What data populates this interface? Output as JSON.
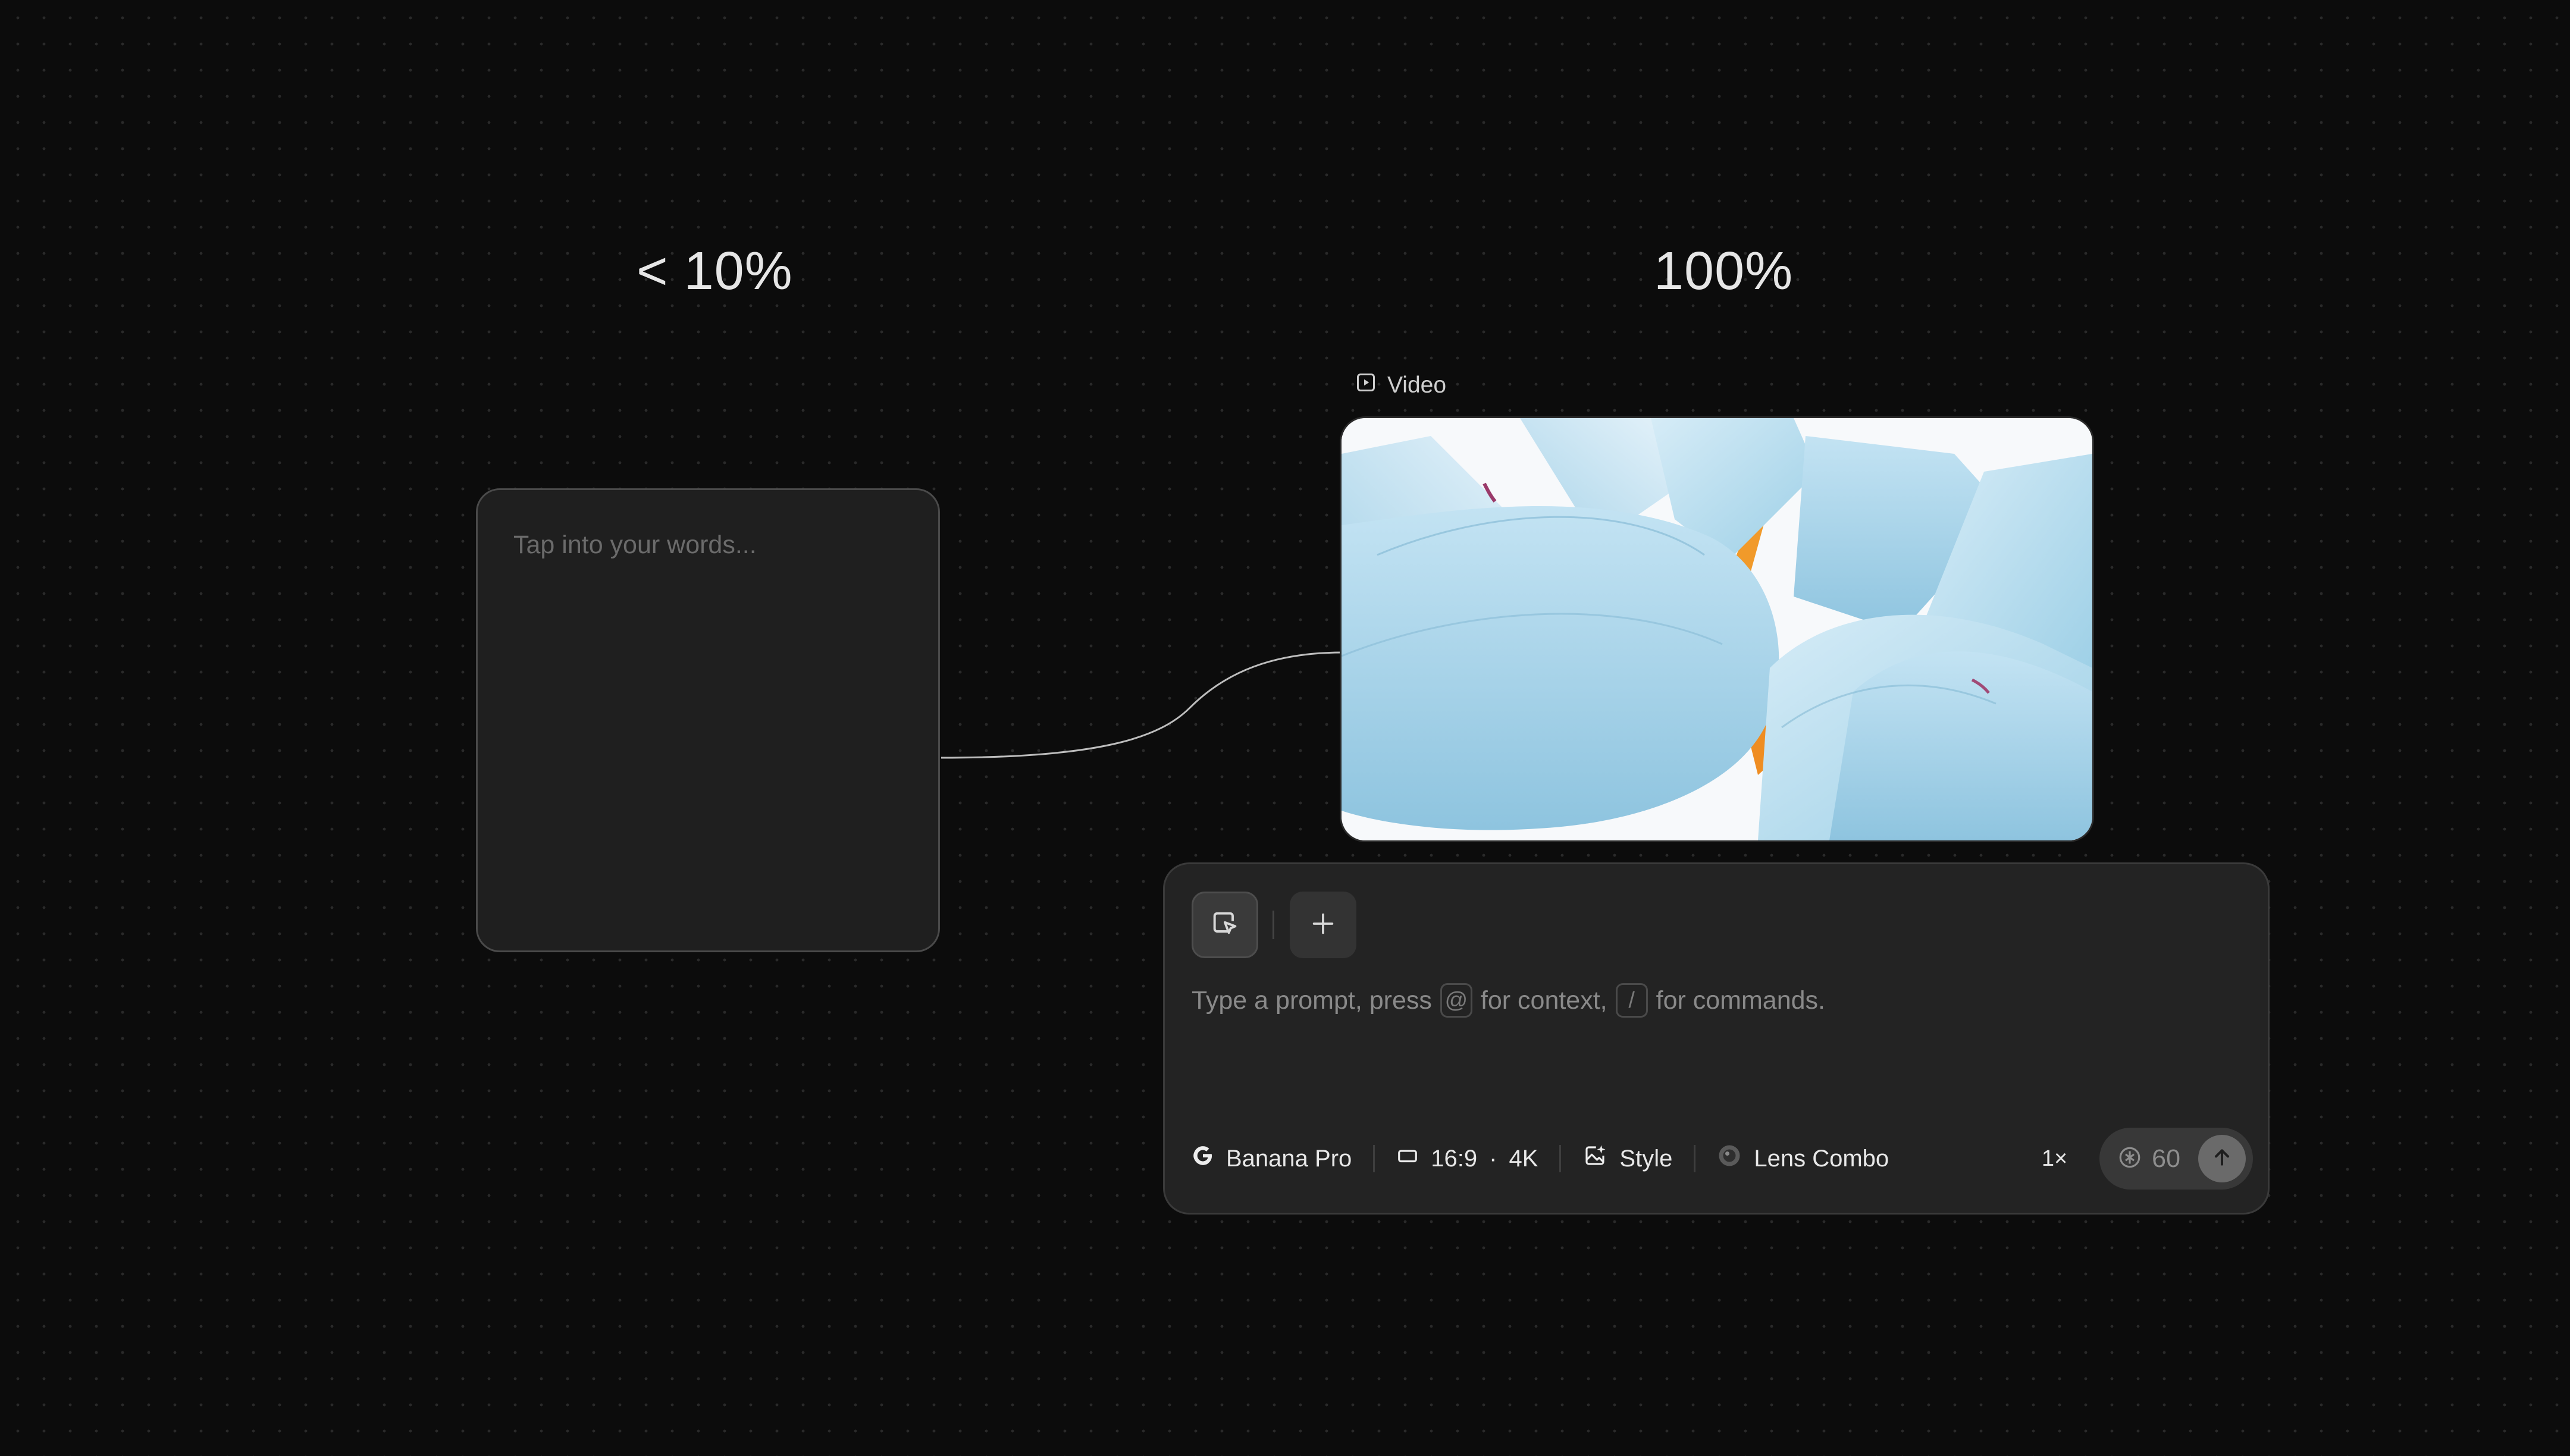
{
  "labels": {
    "left_percent": "< 10%",
    "right_percent": "100%"
  },
  "text_node": {
    "placeholder": "Tap into your words..."
  },
  "video_node": {
    "label": "Video",
    "icon": "play-square-icon",
    "image": "pale blue lotus flower petals on white background"
  },
  "prompt": {
    "tools": [
      {
        "name": "select",
        "icon": "cursor-select-icon"
      },
      {
        "name": "add",
        "icon": "plus-icon"
      }
    ],
    "placeholder_parts": {
      "part1": "Type a prompt, press",
      "key_at": "@",
      "part2": "for context,",
      "key_slash": "/",
      "part3": "for commands."
    },
    "options": {
      "model": {
        "label": "Banana Pro",
        "icon": "google-g-icon"
      },
      "aspect": {
        "ratio": "16:9",
        "dot": "·",
        "resolution": "4K",
        "icon": "aspect-ratio-icon"
      },
      "style": {
        "label": "Style",
        "icon": "image-sparkle-icon"
      },
      "lens": {
        "label": "Lens Combo",
        "icon": "lens-icon"
      }
    },
    "count": "1×",
    "credits": "60",
    "send_icon": "arrow-up-icon"
  },
  "colors": {
    "background": "#0c0c0c",
    "panel": "#232323",
    "node": "#1f1f1f",
    "text_primary": "#e8e8e8",
    "text_muted": "#8a8a8a"
  }
}
